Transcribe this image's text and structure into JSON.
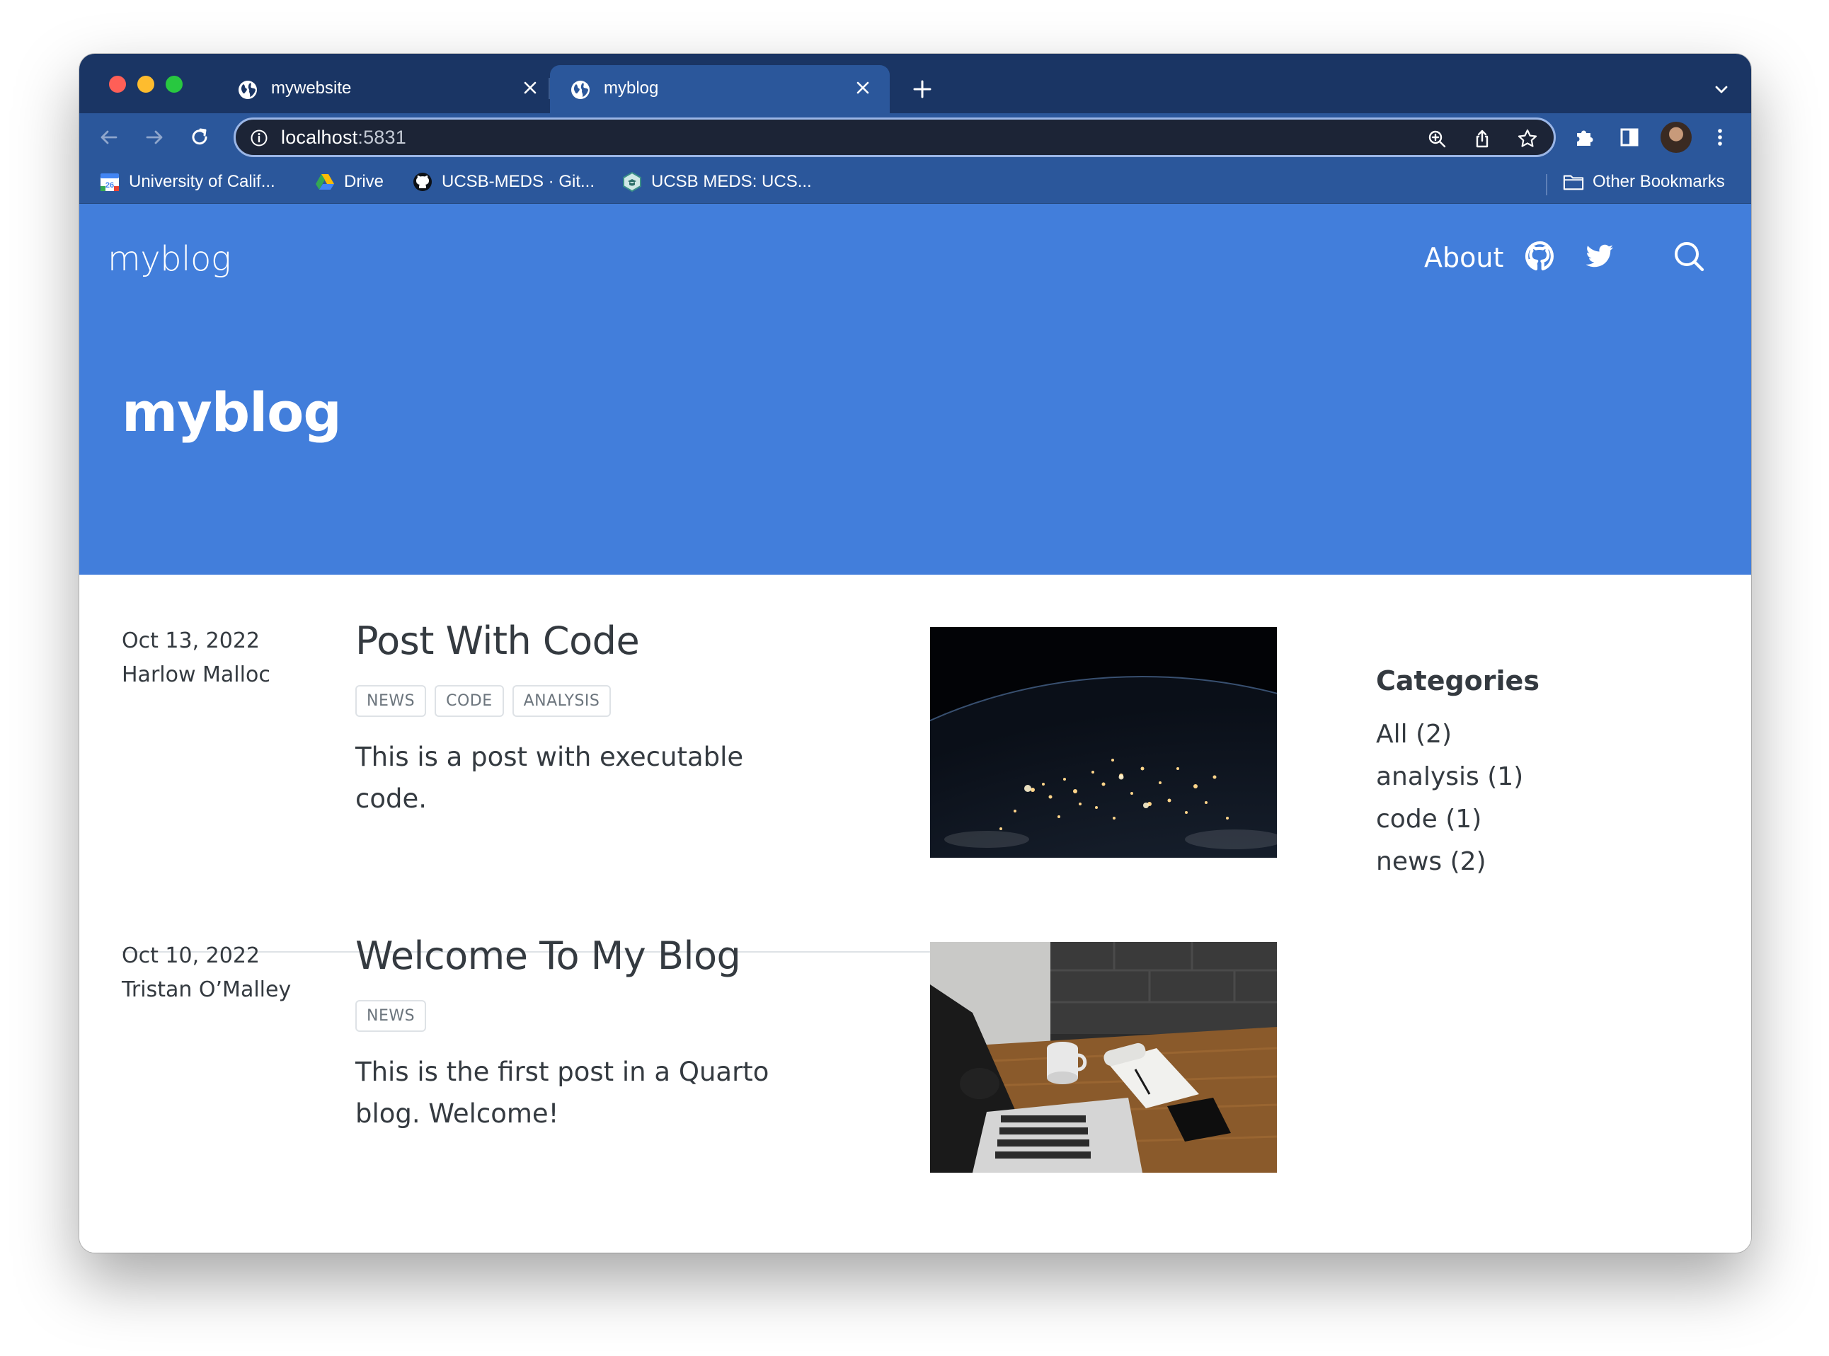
{
  "browser": {
    "tabs": [
      {
        "title": "mywebsite",
        "active": false
      },
      {
        "title": "myblog",
        "active": true
      }
    ],
    "address": {
      "host": "localhost",
      "port": ":5831"
    },
    "bookmarks": [
      {
        "label": "University of Calif...",
        "icon": "calendar-icon"
      },
      {
        "label": "Drive",
        "icon": "google-drive-icon"
      },
      {
        "label": "UCSB-MEDS · Git...",
        "icon": "github-icon"
      },
      {
        "label": "UCSB MEDS: UCS...",
        "icon": "meds-icon"
      }
    ],
    "other_bookmarks": "Other Bookmarks"
  },
  "site": {
    "brand": "myblog",
    "nav": {
      "about": "About"
    },
    "title": "myblog",
    "accent_color": "#427edb"
  },
  "posts": [
    {
      "date": "Oct 13, 2022",
      "author": "Harlow Malloc",
      "title": "Post With Code",
      "categories": [
        "news",
        "code",
        "analysis"
      ],
      "description": "This is a post with executable code.",
      "image": "earth-at-night"
    },
    {
      "date": "Oct 10, 2022",
      "author": "Tristan O’Malley",
      "title": "Welcome To My Blog",
      "categories": [
        "news"
      ],
      "description": "This is the first post in a Quarto blog. Welcome!",
      "image": "laptop-desk"
    }
  ],
  "sidebar": {
    "heading": "Categories",
    "items": [
      "All (2)",
      "analysis (1)",
      "code (1)",
      "news (2)"
    ]
  }
}
